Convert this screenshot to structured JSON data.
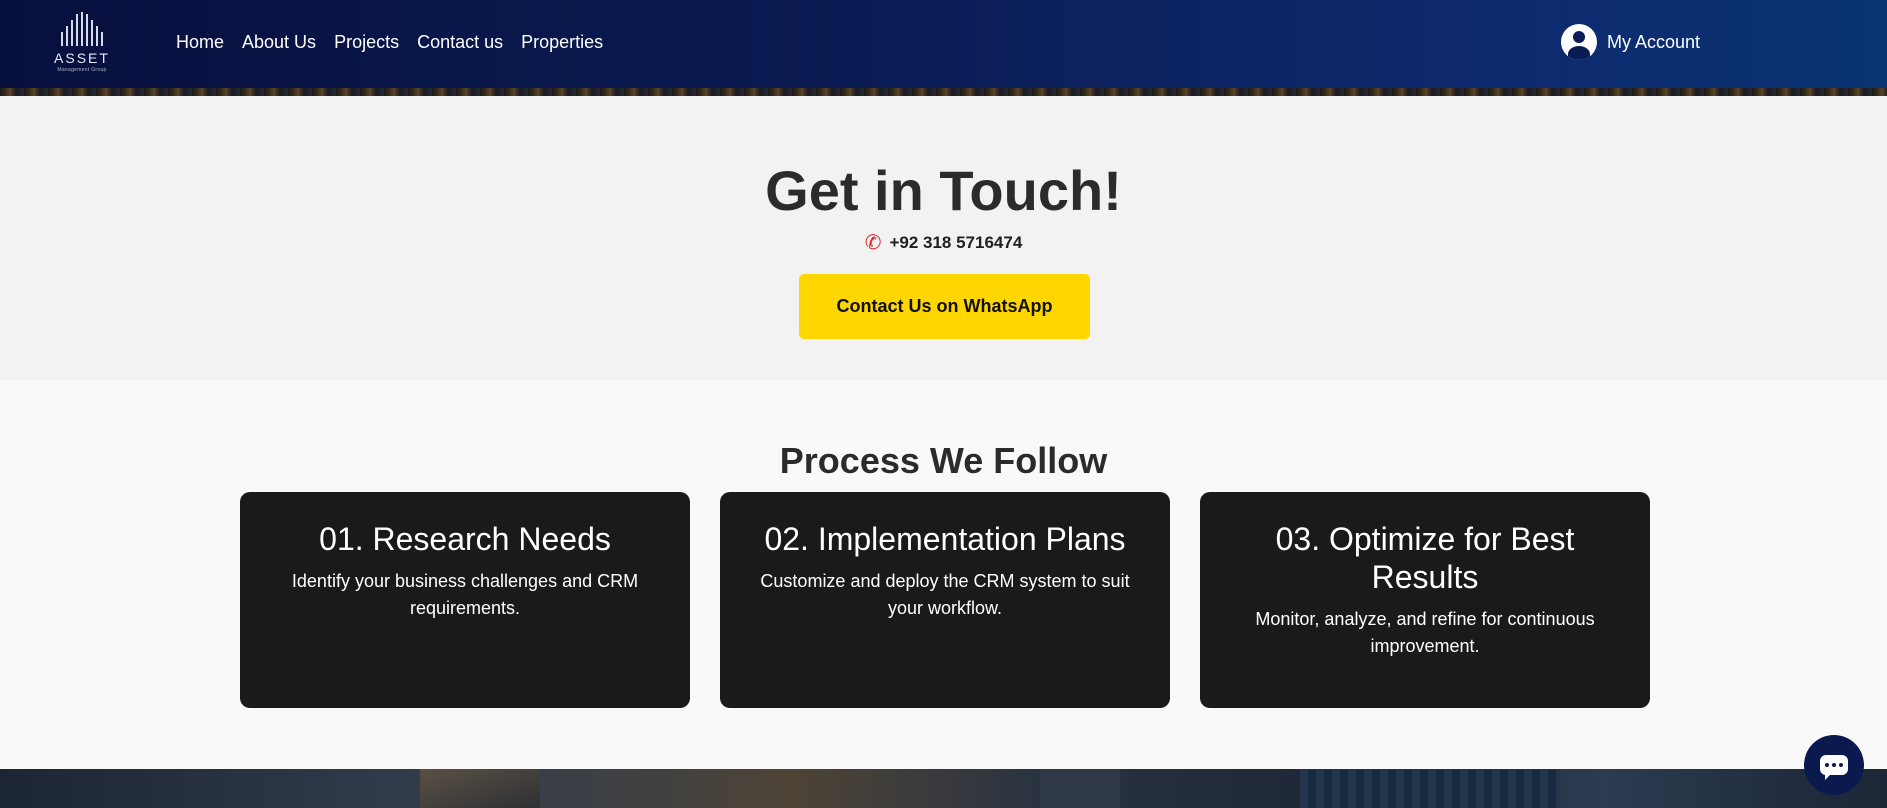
{
  "brand": {
    "name": "ASSET",
    "tagline": "Management Group"
  },
  "nav": {
    "items": [
      {
        "label": "Home"
      },
      {
        "label": "About Us"
      },
      {
        "label": "Projects"
      },
      {
        "label": "Contact us"
      },
      {
        "label": "Properties"
      }
    ]
  },
  "account": {
    "label": "My Account",
    "icon": "user-circle-icon"
  },
  "contact": {
    "title": "Get in Touch!",
    "phone": "+92 318 5716474",
    "phone_icon": "phone-icon",
    "button_label": "Contact Us on WhatsApp",
    "button_color": "#ffd600"
  },
  "process": {
    "title": "Process We Follow",
    "steps": [
      {
        "title": "01. Research Needs",
        "description": "Identify your business challenges and CRM requirements."
      },
      {
        "title": "02. Implementation Plans",
        "description": "Customize and deploy the CRM system to suit your workflow."
      },
      {
        "title": "03. Optimize for Best Results",
        "description": "Monitor, analyze, and refine for continuous improvement."
      }
    ]
  },
  "chat": {
    "icon": "chat-icon"
  },
  "colors": {
    "header": "#0b1c54",
    "card": "#1a1a1a",
    "accent": "#ffd600",
    "phone_icon": "#e0262a"
  }
}
